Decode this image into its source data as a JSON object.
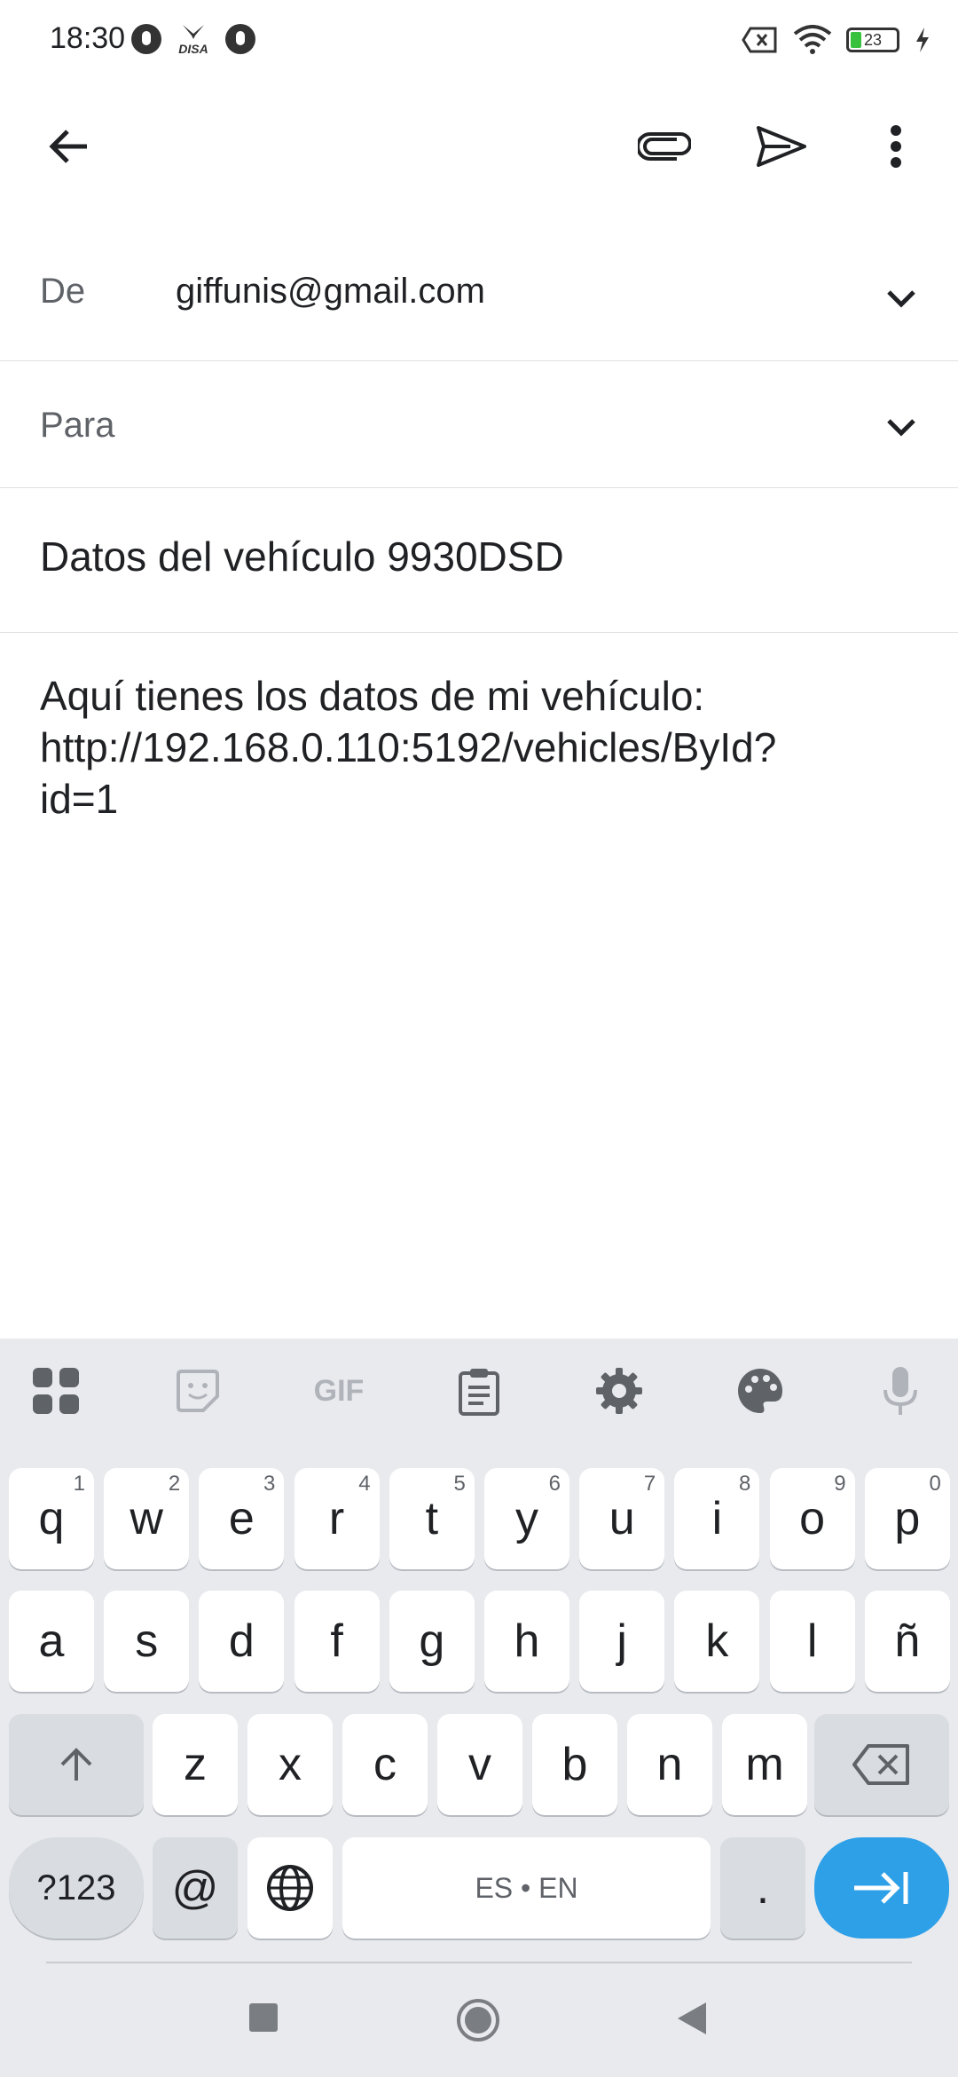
{
  "status_bar": {
    "time": "18:30",
    "left_icons": [
      "app-circle-icon",
      "disa-icon",
      "app-circle-icon"
    ],
    "disa_label": "DISA",
    "battery": "23",
    "right_icons": [
      "no-sim-icon",
      "wifi-icon",
      "battery-icon",
      "charging-icon"
    ]
  },
  "toolbar": {
    "back": "back-arrow-icon",
    "attach": "paperclip-icon",
    "send": "send-icon",
    "more": "more-vert-icon"
  },
  "compose": {
    "from_label": "De",
    "from_value": "giffunis@gmail.com",
    "to_label": "Para",
    "to_value": "",
    "subject": "Datos del vehículo 9930DSD",
    "body_lines": [
      "Aquí tienes los datos de mi vehículo:",
      "http://192.168.0.110:5192/vehicles/ById?",
      "id=1"
    ]
  },
  "keyboard": {
    "tools": [
      "apps-grid-icon",
      "sticker-icon",
      "gif-icon",
      "clipboard-icon",
      "settings-gear-icon",
      "palette-icon",
      "microphone-icon"
    ],
    "gif_label": "GIF",
    "row1": [
      {
        "k": "q",
        "h": "1"
      },
      {
        "k": "w",
        "h": "2"
      },
      {
        "k": "e",
        "h": "3"
      },
      {
        "k": "r",
        "h": "4"
      },
      {
        "k": "t",
        "h": "5"
      },
      {
        "k": "y",
        "h": "6"
      },
      {
        "k": "u",
        "h": "7"
      },
      {
        "k": "i",
        "h": "8"
      },
      {
        "k": "o",
        "h": "9"
      },
      {
        "k": "p",
        "h": "0"
      }
    ],
    "row2": [
      "a",
      "s",
      "d",
      "f",
      "g",
      "h",
      "j",
      "k",
      "l",
      "ñ"
    ],
    "row3": [
      "z",
      "x",
      "c",
      "v",
      "b",
      "n",
      "m"
    ],
    "sym_label": "?123",
    "at_label": "@",
    "space_label": "ES • EN",
    "period_label": "."
  },
  "colors": {
    "accent": "#2ea0e8",
    "keyboard_bg": "#e8eaed",
    "battery_level": "#37c13c"
  }
}
